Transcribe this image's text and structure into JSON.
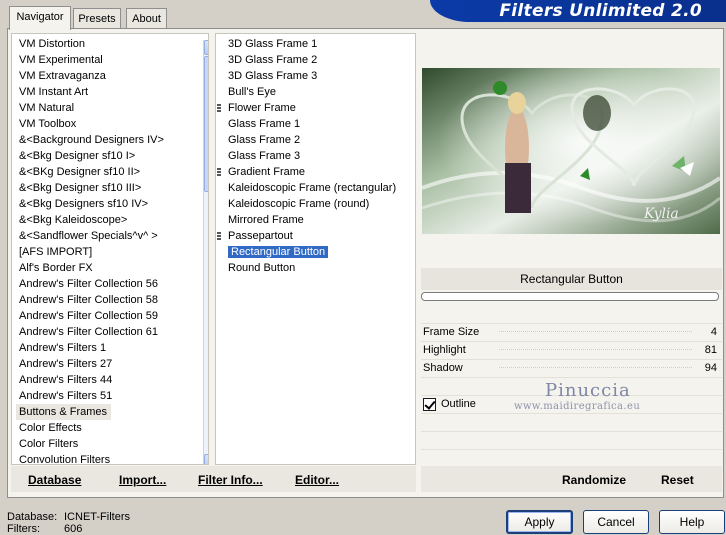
{
  "banner": {
    "title": "Filters Unlimited 2.0"
  },
  "tabs": [
    {
      "label": "Navigator",
      "active": true
    },
    {
      "label": "Presets",
      "active": false
    },
    {
      "label": "About",
      "active": false
    }
  ],
  "categories": {
    "items": [
      "VM Distortion",
      "VM Experimental",
      "VM Extravaganza",
      "VM Instant Art",
      "VM Natural",
      "VM Toolbox",
      "&<Background Designers IV>",
      "&<Bkg Designer sf10 I>",
      "&<BKg Designer sf10 II>",
      "&<Bkg Designer sf10 III>",
      "&<Bkg Designers sf10 IV>",
      "&<Bkg Kaleidoscope>",
      "&<Sandflower Specials^v^ >",
      "[AFS IMPORT]",
      "Alf's Border FX",
      "Andrew's Filter Collection 56",
      "Andrew's Filter Collection 58",
      "Andrew's Filter Collection 59",
      "Andrew's Filter Collection 61",
      "Andrew's Filters 1",
      "Andrew's Filters 27",
      "Andrew's Filters 44",
      "Andrew's Filters 51",
      "Buttons & Frames",
      "Color Effects",
      "Color Filters",
      "Convolution Filters"
    ],
    "selected_index": 23
  },
  "filters": {
    "items": [
      {
        "label": "3D Glass Frame 1",
        "grip": false
      },
      {
        "label": "3D Glass Frame 2",
        "grip": false
      },
      {
        "label": "3D Glass Frame 3",
        "grip": false
      },
      {
        "label": "Bull's Eye",
        "grip": false
      },
      {
        "label": "Flower Frame",
        "grip": true
      },
      {
        "label": "Glass Frame 1",
        "grip": false
      },
      {
        "label": "Glass Frame 2",
        "grip": false
      },
      {
        "label": "Glass Frame 3",
        "grip": false
      },
      {
        "label": "Gradient Frame",
        "grip": true
      },
      {
        "label": "Kaleidoscopic Frame (rectangular)",
        "grip": false
      },
      {
        "label": "Kaleidoscopic Frame (round)",
        "grip": false
      },
      {
        "label": "Mirrored Frame",
        "grip": false
      },
      {
        "label": "Passepartout",
        "grip": true
      },
      {
        "label": "Rectangular Button",
        "grip": false
      },
      {
        "label": "Round Button",
        "grip": false
      }
    ],
    "selected_index": 13
  },
  "left_actions": {
    "database": "Database",
    "import": "Import...",
    "filter_info": "Filter Info...",
    "editor": "Editor..."
  },
  "filter_panel": {
    "title": "Rectangular Button",
    "params": [
      {
        "label": "Frame Size",
        "value": "4"
      },
      {
        "label": "Highlight",
        "value": "81"
      },
      {
        "label": "Shadow",
        "value": "94"
      }
    ],
    "outline": {
      "label": "Outline",
      "checked": true
    },
    "randomize": "Randomize",
    "reset": "Reset"
  },
  "preview": {
    "signature": "Kylia"
  },
  "watermark": {
    "name": "Pinuccia",
    "url": "www.maidiregrafica.eu"
  },
  "status": {
    "database_label": "Database:",
    "database_value": "ICNET-Filters",
    "filters_label": "Filters:",
    "filters_value": "606"
  },
  "buttons": {
    "apply": "Apply",
    "cancel": "Cancel",
    "help": "Help"
  },
  "colors": {
    "banner": "#0b3ba8",
    "selection": "#316ac5"
  }
}
